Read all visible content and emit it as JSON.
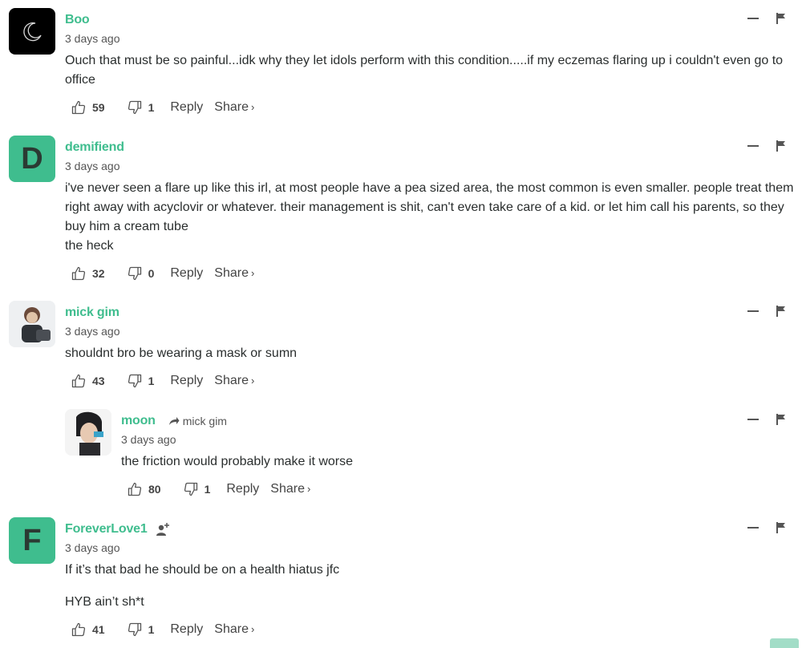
{
  "action_labels": {
    "reply": "Reply",
    "share": "Share",
    "share_chevron": "›"
  },
  "comments": [
    {
      "author": "Boo",
      "time": "3 days ago",
      "avatar": "dark-moon",
      "lines": [
        "Ouch that must be so painful...idk why they let idols perform with this condition.....if my eczemas flaring up i couldn't even go to office"
      ],
      "likes": "59",
      "dislikes": "1"
    },
    {
      "author": "demifiend",
      "time": "3 days ago",
      "avatar_letter": "D",
      "lines": [
        "i've never seen a flare up like this irl, at most people have a pea sized area, the most common is even smaller. people treat them right away with acyclovir or whatever. their management is shit, can't even take care of a kid. or let him call his parents, so they buy him a cream tube",
        "the heck"
      ],
      "likes": "32",
      "dislikes": "0"
    },
    {
      "author": "mick gim",
      "time": "3 days ago",
      "avatar": "photo-figure",
      "lines": [
        "shouldnt bro be wearing a mask or sumn"
      ],
      "likes": "43",
      "dislikes": "1"
    },
    {
      "author": "moon",
      "reply_to": "mick gim",
      "time": "3 days ago",
      "avatar": "photo-person",
      "lines": [
        "the friction would probably make it worse"
      ],
      "likes": "80",
      "dislikes": "1"
    },
    {
      "author": "ForeverLove1",
      "time": "3 days ago",
      "avatar_letter": "F",
      "lines": [
        "If it’s that bad he should be on a health hiatus jfc",
        "",
        "HYB ain’t sh*t"
      ],
      "likes": "41",
      "dislikes": "1"
    }
  ],
  "colors": {
    "accent": "#3fbd8e",
    "text": "#2a2e2e",
    "muted": "#555555"
  }
}
